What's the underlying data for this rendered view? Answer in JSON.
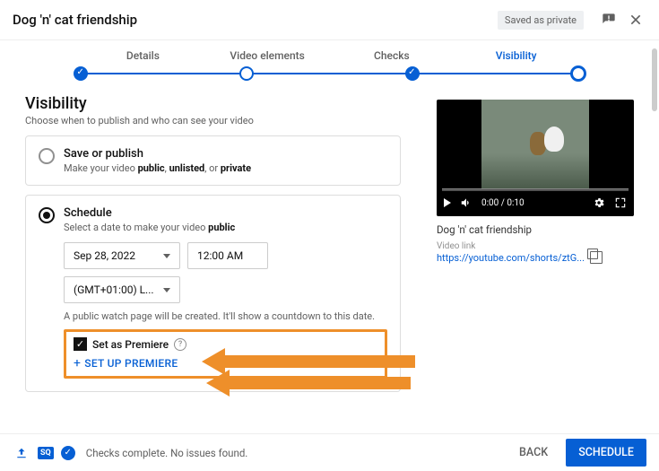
{
  "header": {
    "title": "Dog 'n' cat friendship",
    "saved_chip": "Saved as private"
  },
  "stepper": {
    "steps": [
      "Details",
      "Video elements",
      "Checks",
      "Visibility"
    ]
  },
  "section": {
    "heading": "Visibility",
    "sub": "Choose when to publish and who can see your video"
  },
  "save_option": {
    "title": "Save or publish",
    "sub_prefix": "Make your video ",
    "b1": "public",
    "c1": ", ",
    "b2": "unlisted",
    "c2": ", or ",
    "b3": "private"
  },
  "schedule": {
    "title": "Schedule",
    "sub_prefix": "Select a date to make your video ",
    "sub_bold": "public",
    "date": "Sep 28, 2022",
    "time": "12:00 AM",
    "timezone": "(GMT+01:00) L...",
    "note": "A public watch page will be created. It'll show a countdown to this date.",
    "premiere_label": "Set as Premiere",
    "setup_label": "SET UP PREMIERE"
  },
  "preview": {
    "time": "0:00 / 0:10",
    "title": "Dog 'n' cat friendship",
    "link_label": "Video link",
    "link": "https://youtube.com/shorts/ztG..."
  },
  "footer": {
    "sq": "SQ",
    "status": "Checks complete. No issues found.",
    "back": "BACK",
    "schedule": "SCHEDULE"
  }
}
